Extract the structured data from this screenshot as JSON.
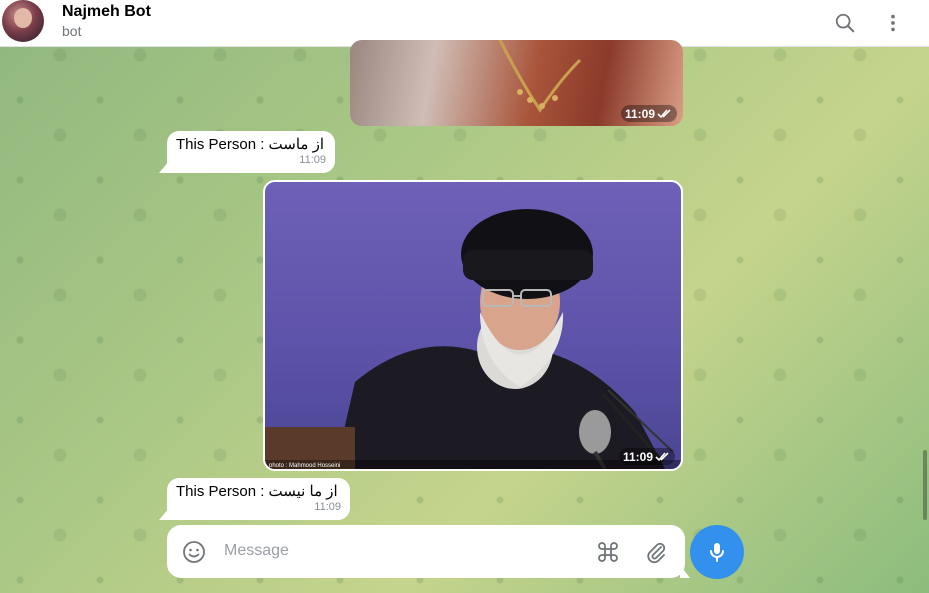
{
  "header": {
    "title": "Najmeh Bot",
    "subtitle": "bot",
    "search_icon": "search-icon",
    "more_icon": "more-vertical-icon"
  },
  "messages": [
    {
      "type": "photo",
      "time": "11:09",
      "status": "read"
    },
    {
      "type": "text",
      "text": "This Person : از ماست",
      "time": "11:09"
    },
    {
      "type": "photo",
      "time": "11:09",
      "status": "read",
      "caption_overlay": "photo : Mahmood Hosseini"
    },
    {
      "type": "text",
      "text": "This Person : از ما نیست",
      "time": "11:09"
    }
  ],
  "composer": {
    "placeholder": "Message",
    "value": "",
    "emoji_icon": "emoji-icon",
    "command_icon": "command-icon",
    "attach_icon": "paperclip-icon",
    "mic_icon": "microphone-icon"
  },
  "colors": {
    "accent": "#3390ec",
    "header_bg": "#ffffff",
    "bubble_bg": "#ffffff"
  }
}
